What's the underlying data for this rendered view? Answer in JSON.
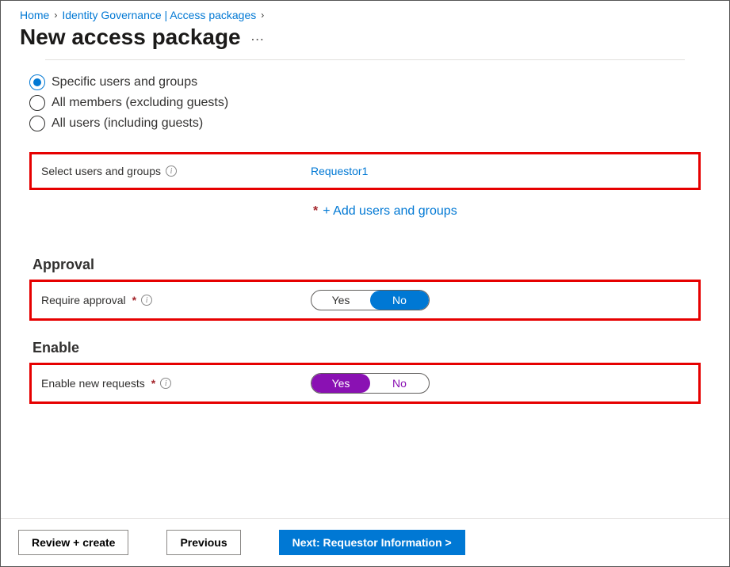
{
  "breadcrumb": {
    "home": "Home",
    "parent": "Identity Governance | Access packages"
  },
  "page_title": "New access package",
  "more_icon": "…",
  "radio": {
    "specific": "Specific users and groups",
    "members": "All members (excluding guests)",
    "all": "All users (including guests)"
  },
  "select_users": {
    "label": "Select users and groups",
    "value": "Requestor1",
    "add_label": "+ Add users and groups"
  },
  "approval": {
    "heading": "Approval",
    "label": "Require approval",
    "yes": "Yes",
    "no": "No"
  },
  "enable": {
    "heading": "Enable",
    "label": "Enable new requests",
    "yes": "Yes",
    "no": "No"
  },
  "footer": {
    "review": "Review + create",
    "previous": "Previous",
    "next": "Next: Requestor Information >"
  }
}
